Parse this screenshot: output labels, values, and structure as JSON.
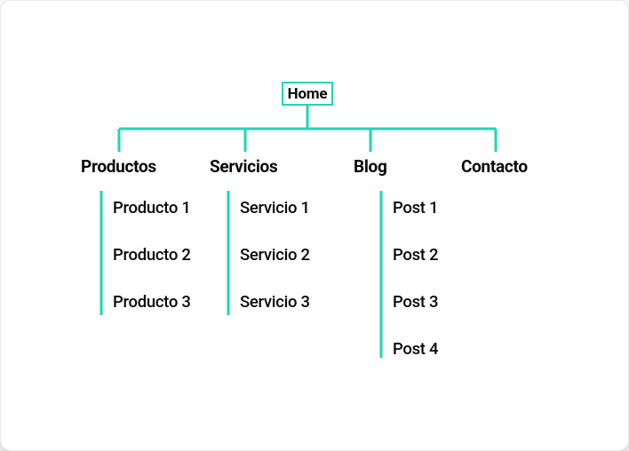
{
  "root": {
    "label": "Home"
  },
  "categories": [
    {
      "label": "Productos",
      "items": [
        "Producto 1",
        "Producto 2",
        "Producto 3"
      ]
    },
    {
      "label": "Servicios",
      "items": [
        "Servicio 1",
        "Servicio 2",
        "Servicio 3"
      ]
    },
    {
      "label": "Blog",
      "items": [
        "Post 1",
        "Post 2",
        "Post 3",
        "Post 4"
      ]
    },
    {
      "label": "Contacto",
      "items": []
    }
  ],
  "colors": {
    "accent": "#1ed6b7",
    "text": "#0a0a0a"
  }
}
